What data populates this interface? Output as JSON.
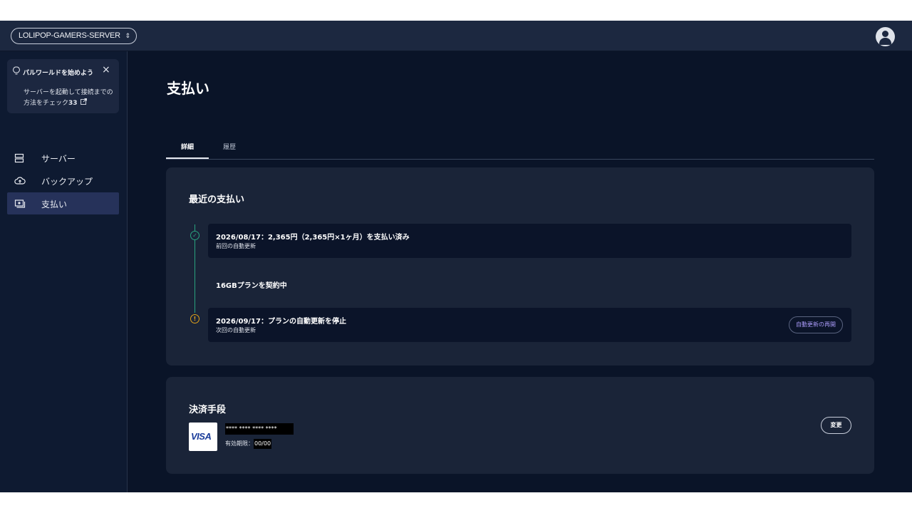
{
  "topbar": {
    "server_name": "LOLIPOP-GAMERS-SERVER",
    "chevron": "⌃⌄"
  },
  "sidebar": {
    "tip": {
      "title": "パルワールドを始めよう",
      "text_before": "サーバーを起動して接続までの方法をチェック",
      "text_num": "33"
    },
    "items": [
      {
        "label": "サーバー",
        "icon": "server-icon"
      },
      {
        "label": "バックアップ",
        "icon": "cloud-upload-icon"
      },
      {
        "label": "支払い",
        "icon": "payment-icon",
        "active": true
      }
    ]
  },
  "main": {
    "page_title": "支払い",
    "tabs": [
      {
        "label": "詳細",
        "active": true
      },
      {
        "label": "履歴",
        "active": false
      }
    ],
    "recent": {
      "title": "最近の支払い",
      "rows": [
        {
          "main": "2026/08/17：2,365円（2,365円×1ヶ月）を支払い済み",
          "sub": "前回の自動更新",
          "status": "paid"
        },
        {
          "main": "16GBプランを契約中"
        },
        {
          "main": "2026/09/17：プランの自動更新を停止",
          "sub": "次回の自動更新",
          "status": "warning"
        }
      ],
      "resume_button": "自動更新の再開"
    },
    "method": {
      "title": "決済手段",
      "brand": "VISA",
      "card_number": "**** **** **** ****",
      "expiry_label": "有効期限：",
      "expiry_value": "00/00",
      "change_button": "変更"
    }
  },
  "colors": {
    "background": "#0a1428",
    "topbar": "#1c2840",
    "card": "#1a2438",
    "success": "#29a37f",
    "warning": "#e0a21a",
    "accent": "#a99af8"
  }
}
